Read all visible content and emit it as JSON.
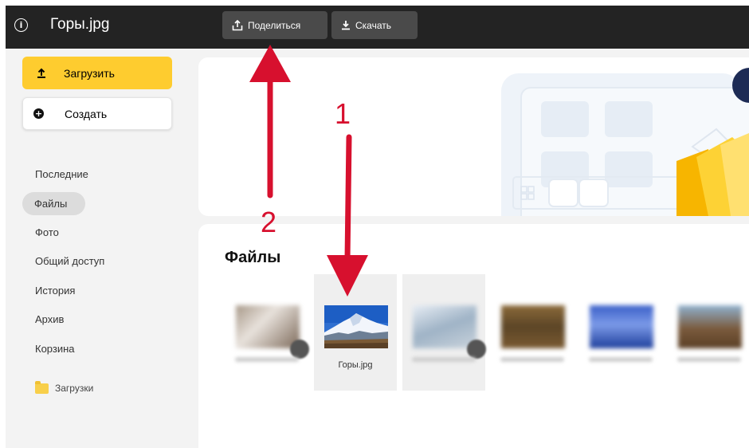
{
  "topbar": {
    "file_name": "Горы.jpg",
    "share_label": "Поделиться",
    "download_label": "Скачать"
  },
  "sidebar": {
    "upload_label": "Загрузить",
    "create_label": "Создать",
    "nav": [
      {
        "label": "Последние"
      },
      {
        "label": "Файлы",
        "active": true
      },
      {
        "label": "Фото"
      },
      {
        "label": "Общий доступ"
      },
      {
        "label": "История"
      },
      {
        "label": "Архив"
      },
      {
        "label": "Корзина"
      }
    ],
    "folder_label": "Загрузки"
  },
  "main": {
    "heading": "Файлы",
    "files": [
      {
        "name": "",
        "blurred": true
      },
      {
        "name": "Горы.jpg",
        "blurred": false,
        "selected": true
      },
      {
        "name": "",
        "blurred": true,
        "selected": true
      },
      {
        "name": "",
        "blurred": true
      },
      {
        "name": "",
        "blurred": true
      },
      {
        "name": "",
        "blurred": true
      }
    ]
  },
  "annotations": {
    "label_1": "1",
    "label_2": "2",
    "color": "#d7102e"
  },
  "colors": {
    "topbar": "#232323",
    "upload_button": "#fecc2f",
    "sidebar_bg": "#f3f3f3"
  }
}
